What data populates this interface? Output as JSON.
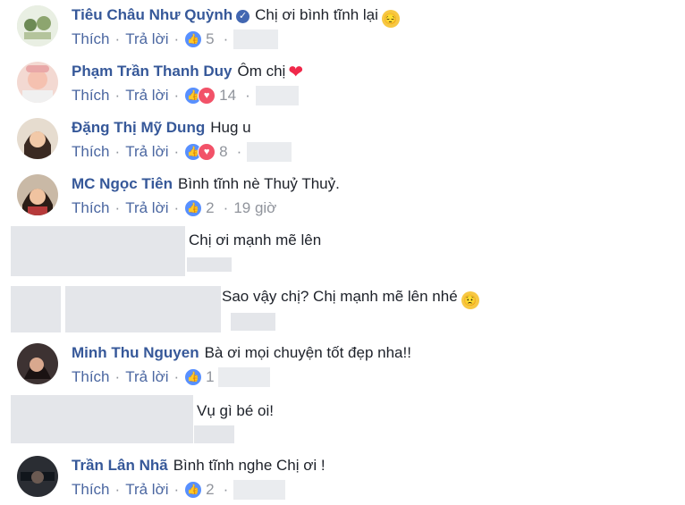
{
  "comments": [
    {
      "name": "Tiêu Châu Như Quỳnh",
      "text": "Chị ơi bình tĩnh lại",
      "emoji": "😔",
      "like": "Thích",
      "reply": "Trả lời",
      "count": "5",
      "reactions": [
        "like"
      ]
    },
    {
      "name": "Phạm Trần Thanh Duy",
      "text": "Ôm chị",
      "heart": "❤",
      "like": "Thích",
      "reply": "Trả lời",
      "count": "14",
      "reactions": [
        "like",
        "love"
      ]
    },
    {
      "name": "Đặng Thị Mỹ Dung",
      "text": "Hug u",
      "like": "Thích",
      "reply": "Trả lời",
      "count": "8",
      "reactions": [
        "like",
        "love"
      ]
    },
    {
      "name": "MC Ngọc Tiên",
      "text": "Bình tĩnh nè Thuỷ Thuỷ.",
      "like": "Thích",
      "reply": "Trả lời",
      "count": "2",
      "time": "19 giờ",
      "reactions": [
        "like"
      ]
    },
    {
      "text": "Chị ơi mạnh mẽ lên"
    },
    {
      "text": "Sao vậy chị? Chị mạnh mẽ lên nhé",
      "emoji": "😟"
    },
    {
      "name": "Minh Thu Nguyen",
      "text": "Bà ơi mọi chuyện tốt đẹp nha!!",
      "like": "Thích",
      "reply": "Trả lời",
      "count": "1",
      "reactions": [
        "like"
      ]
    },
    {
      "text": "Vụ gì bé oi!"
    },
    {
      "name": "Trần Lân Nhã",
      "text": "Bình tĩnh nghe Chị ơi !",
      "like": "Thích",
      "reply": "Trả lời",
      "count": "2",
      "reactions": [
        "like"
      ]
    }
  ],
  "colors": {
    "name": "#365899",
    "meta": "#4b67a1",
    "like": "#5890ff",
    "love": "#f25268"
  }
}
